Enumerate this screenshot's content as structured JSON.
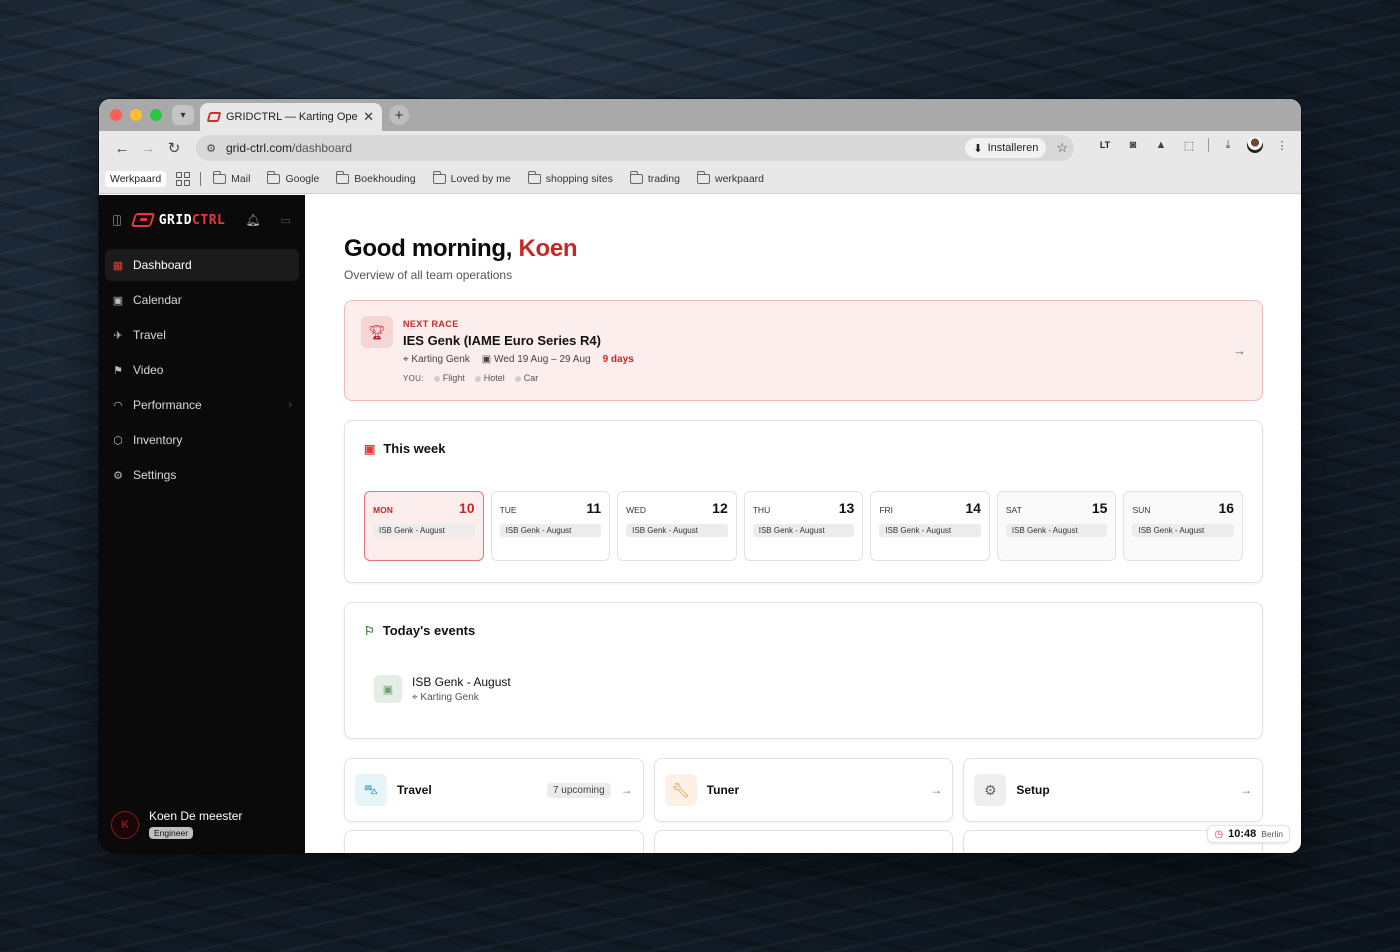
{
  "browser": {
    "tab_title": "GRIDCTRL — Karting Operatio",
    "url_host": "grid-ctrl.com",
    "url_path": "/dashboard",
    "install_label": "Installeren",
    "profile_bookmark": "Werkpaard",
    "bookmarks": [
      "Mail",
      "Google",
      "Boekhouding",
      "Loved by me",
      "shopping sites",
      "trading",
      "werkpaard"
    ]
  },
  "sidebar": {
    "logo_grid": "GRID",
    "logo_ctrl": "CTRL",
    "items": [
      {
        "label": "Dashboard",
        "icon": "grid-icon",
        "active": true
      },
      {
        "label": "Calendar",
        "icon": "calendar-icon"
      },
      {
        "label": "Travel",
        "icon": "plane-icon"
      },
      {
        "label": "Video",
        "icon": "flag-icon"
      },
      {
        "label": "Performance",
        "icon": "gauge-icon"
      },
      {
        "label": "Inventory",
        "icon": "box-icon"
      },
      {
        "label": "Settings",
        "icon": "gear-icon"
      }
    ],
    "user": {
      "initial": "K",
      "name": "Koen De meester",
      "role": "Engineer"
    }
  },
  "main": {
    "greeting": "Good morning, ",
    "user_first": "Koen",
    "subtitle": "Overview of all team operations",
    "next_race": {
      "label": "NEXT RACE",
      "title": "IES Genk (IAME Euro Series R4)",
      "location": "Karting Genk",
      "dates": "Wed 19 Aug – 29 Aug",
      "countdown": "9 days",
      "you_label": "YOU:",
      "flight": "Flight",
      "hotel": "Hotel",
      "car": "Car"
    },
    "this_week": {
      "title": "This week",
      "days": [
        {
          "name": "MON",
          "num": "10",
          "event": "ISB Genk - August"
        },
        {
          "name": "TUE",
          "num": "11",
          "event": "ISB Genk - August"
        },
        {
          "name": "WED",
          "num": "12",
          "event": "ISB Genk - August"
        },
        {
          "name": "THU",
          "num": "13",
          "event": "ISB Genk - August"
        },
        {
          "name": "FRI",
          "num": "14",
          "event": "ISB Genk - August"
        },
        {
          "name": "SAT",
          "num": "15",
          "event": "ISB Genk - August"
        },
        {
          "name": "SUN",
          "num": "16",
          "event": "ISB Genk - August"
        }
      ]
    },
    "today_events": {
      "title": "Today's events",
      "event_title": "ISB Genk - August",
      "event_location": "Karting Genk"
    },
    "quick_links": {
      "travel": "Travel",
      "travel_badge": "7 upcoming",
      "tuner": "Tuner",
      "setup": "Setup"
    },
    "clock": {
      "time": "10:48",
      "city": "Berlin"
    }
  }
}
